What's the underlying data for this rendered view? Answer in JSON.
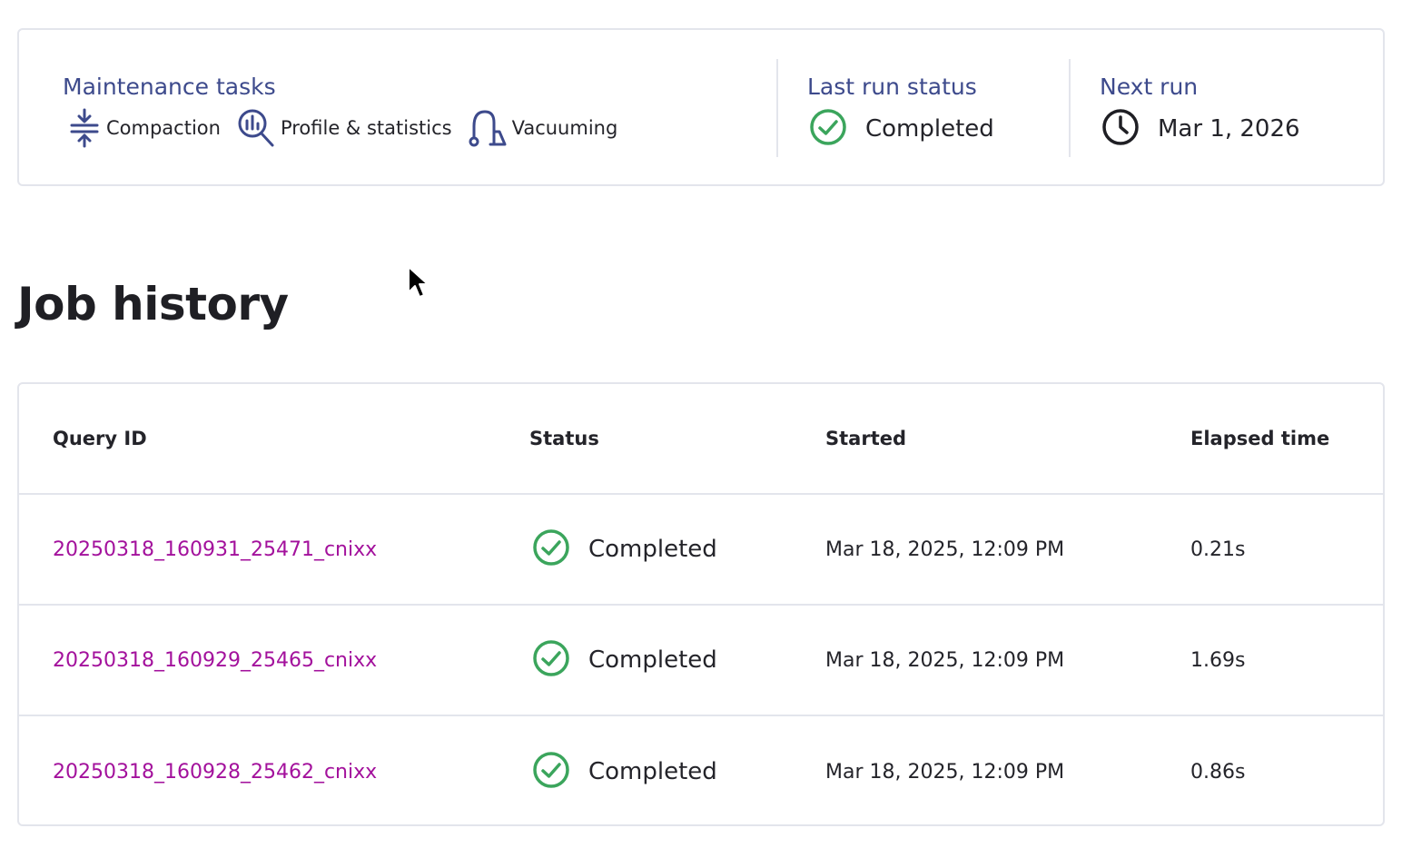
{
  "summary": {
    "maintenance": {
      "label": "Maintenance tasks",
      "tasks": [
        {
          "label": "Compaction",
          "icon": "compaction-icon"
        },
        {
          "label": "Profile & statistics",
          "icon": "profile-statistics-icon"
        },
        {
          "label": "Vacuuming",
          "icon": "vacuum-icon"
        }
      ]
    },
    "last_run": {
      "label": "Last run status",
      "value": "Completed",
      "icon": "check-circle-icon"
    },
    "next_run": {
      "label": "Next run",
      "value": "Mar 1, 2026",
      "icon": "clock-icon"
    }
  },
  "job_history": {
    "title": "Job history",
    "columns": [
      "Query ID",
      "Status",
      "Started",
      "Elapsed time"
    ],
    "rows": [
      {
        "query_id": "20250318_160931_25471_cnixx",
        "status": "Completed",
        "started": "Mar 18, 2025, 12:09 PM",
        "elapsed": "0.21s"
      },
      {
        "query_id": "20250318_160929_25465_cnixx",
        "status": "Completed",
        "started": "Mar 18, 2025, 12:09 PM",
        "elapsed": "1.69s"
      },
      {
        "query_id": "20250318_160928_25462_cnixx",
        "status": "Completed",
        "started": "Mar 18, 2025, 12:09 PM",
        "elapsed": "0.86s"
      }
    ]
  },
  "colors": {
    "accent_label": "#3d4a8c",
    "link": "#a3119c",
    "success": "#3ba55c",
    "border": "#e3e5ec"
  }
}
